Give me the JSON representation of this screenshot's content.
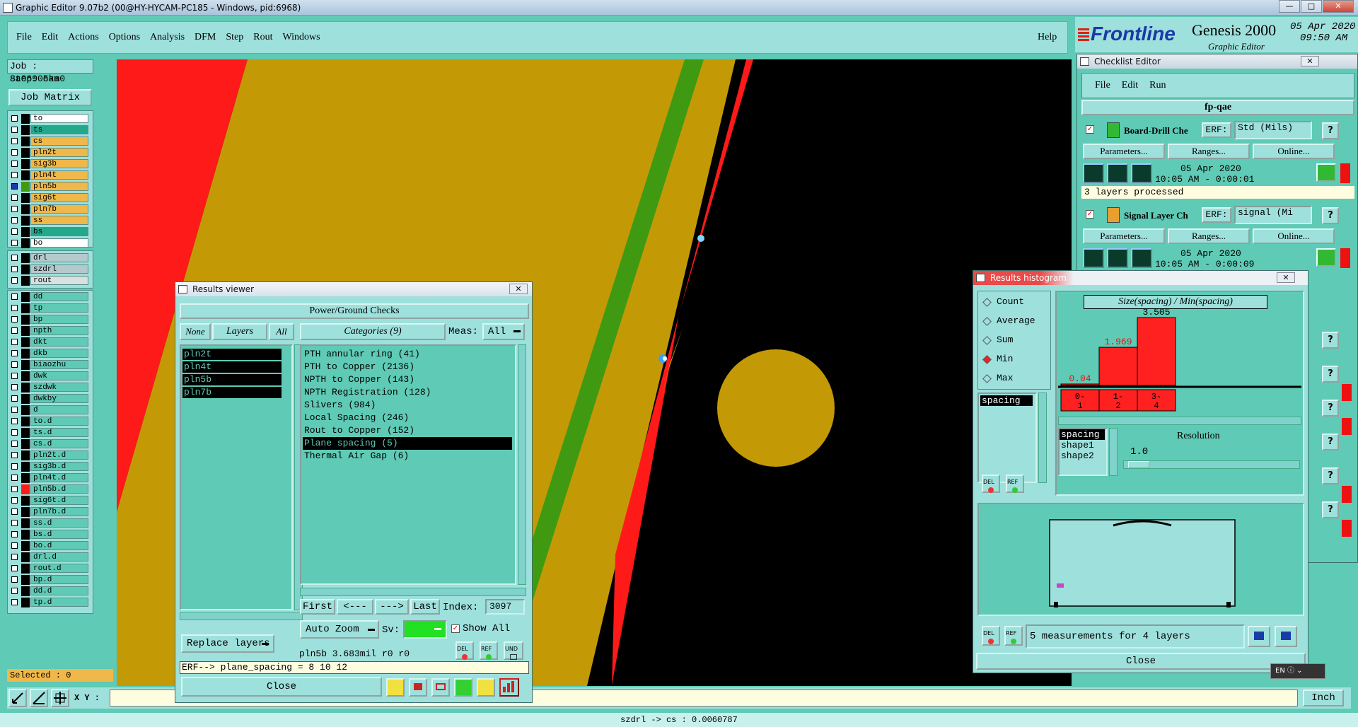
{
  "window_title": "Graphic Editor 9.07b2 (00@HY-HYCAM-PC185 - Windows, pid:6968)",
  "menu": [
    "File",
    "Edit",
    "Actions",
    "Options",
    "Analysis",
    "DFM",
    "Step",
    "Rout",
    "Windows"
  ],
  "help_label": "Help",
  "brand": {
    "logo": "Frontline",
    "product": "Genesis 2000",
    "subtitle": "Graphic Editor",
    "date": "05 Apr 2020",
    "time": "09:50 AM"
  },
  "job": {
    "job_label": "Job : 8a06905ka0",
    "step_label": "Step: cam",
    "matrix_button": "Job Matrix ..."
  },
  "layers_group1": [
    {
      "name": "to",
      "color": "#ffffff"
    },
    {
      "name": "ts",
      "color": "#24a78a"
    },
    {
      "name": "cs",
      "color": "#f0b84a"
    },
    {
      "name": "pln2t",
      "color": "#f0b84a"
    },
    {
      "name": "sig3b",
      "color": "#f0b84a"
    },
    {
      "name": "pln4t",
      "color": "#f0b84a"
    },
    {
      "name": "pln5b",
      "color": "#f0b84a"
    },
    {
      "name": "sig6t",
      "color": "#f0b84a"
    },
    {
      "name": "pln7b",
      "color": "#f0b84a"
    },
    {
      "name": "ss",
      "color": "#f0b84a"
    },
    {
      "name": "bs",
      "color": "#24a78a"
    },
    {
      "name": "bo",
      "color": "#ffffff"
    }
  ],
  "layers_group2": [
    {
      "name": "drl",
      "color": "#b5c8cc"
    },
    {
      "name": "szdrl",
      "color": "#b5c8cc"
    },
    {
      "name": "rout",
      "color": "#d8e0e0"
    }
  ],
  "layers_group3": [
    "dd",
    "tp",
    "bp",
    "npth",
    "dkt",
    "dkb",
    "biaozhu",
    "dwk",
    "szdwk",
    "dwkby",
    "d",
    "to.d",
    "ts.d",
    "cs.d",
    "pln2t.d",
    "sig3b.d",
    "pln4t.d",
    "pln5b.d",
    "sig6t.d",
    "pln7b.d",
    "ss.d",
    "bs.d",
    "bo.d",
    "drl.d",
    "rout.d",
    "bp.d",
    "dd.d",
    "tp.d"
  ],
  "selected_label": "Selected : 0",
  "xy_label": "X Y :",
  "units_label": "Inch",
  "status_line": "szdrl -> cs : 0.0060787",
  "results_viewer": {
    "title": "Results viewer",
    "header": "Power/Ground Checks",
    "none_btn": "None",
    "layers_btn": "Layers",
    "all_btn": "All",
    "categories_label": "Categories (9)",
    "meas_label": "Meas:",
    "meas_value": "All",
    "layers": [
      "pln2t",
      "pln4t",
      "pln5b",
      "pln7b"
    ],
    "categories": [
      "PTH annular ring (41)",
      "PTH to Copper (2136)",
      "NPTH to Copper (143)",
      "NPTH Registration (128)",
      "Slivers (984)",
      "Local Spacing (246)",
      "Rout to Copper (152)",
      "Plane spacing (5)",
      "Thermal Air Gap (6)"
    ],
    "selected_category": "Plane spacing (5)",
    "first_btn": "First",
    "prev_btn": "<---",
    "next_btn": "--->",
    "last_btn": "Last",
    "index_label": "Index:",
    "index_value": "3097",
    "auto_zoom": "Auto Zoom",
    "sv_label": "Sv:",
    "show_all": "Show All",
    "replace_layers": "Replace layers",
    "info": "pln5b 3.683mil  r0  r0",
    "erf": "ERF--> plane_spacing = 8 10 12",
    "close": "Close",
    "del": "DEL",
    "ref": "REF",
    "und": "UND"
  },
  "checklist": {
    "title": "Checklist Editor",
    "menu": [
      "File",
      "Edit",
      "Run"
    ],
    "name": "fp-qae",
    "checks": [
      {
        "name": "Board-Drill Che",
        "erf": "ERF:",
        "erf_value": "Std (Mils)",
        "parameters": "Parameters...",
        "ranges": "Ranges...",
        "online": "Online...",
        "date": "05 Apr 2020",
        "time": "10:05 AM - 0:00:01",
        "status": "3 layers processed"
      },
      {
        "name": "Signal Layer Ch",
        "erf": "ERF:",
        "erf_value": "signal (Mi",
        "parameters": "Parameters...",
        "ranges": "Ranges...",
        "online": "Online...",
        "date": "05 Apr 2020",
        "time": "10:05 AM - 0:00:09",
        "status": ""
      }
    ],
    "help_q": "?"
  },
  "histogram": {
    "title": "Results histogram",
    "modes": [
      "Count",
      "Average",
      "Sum",
      "Min",
      "Max"
    ],
    "selected_mode": "Min",
    "graph_title": "Size(spacing) / Min(spacing)",
    "measure_items": [
      "spacing"
    ],
    "bins": [
      {
        "label": "0-\n1",
        "value": 0.04,
        "value_text": "0.04",
        "range": [
          "0-",
          "1"
        ]
      },
      {
        "label": "1-\n2",
        "value": 1.969,
        "value_text": "1.969",
        "range": [
          "1-",
          "2"
        ]
      },
      {
        "label": "3-\n4",
        "value": 3.505,
        "value_text": "3.505",
        "range": [
          "3-",
          "4"
        ]
      }
    ],
    "shapes": [
      "spacing",
      "shape1",
      "shape2"
    ],
    "resolution_label": "Resolution",
    "resolution_value": "1.0",
    "measurements": "5 measurements for 4 layers",
    "close": "Close",
    "del": "DEL",
    "ref": "REF"
  },
  "colors": {
    "canvas_bg": "#000000",
    "copper": "#c39a06",
    "red_layer": "#ff1a1a",
    "green_layer": "#3f9a12",
    "pad": "#c39a06",
    "panel": "#9ee0dc",
    "app_bg": "#5fcab5"
  }
}
